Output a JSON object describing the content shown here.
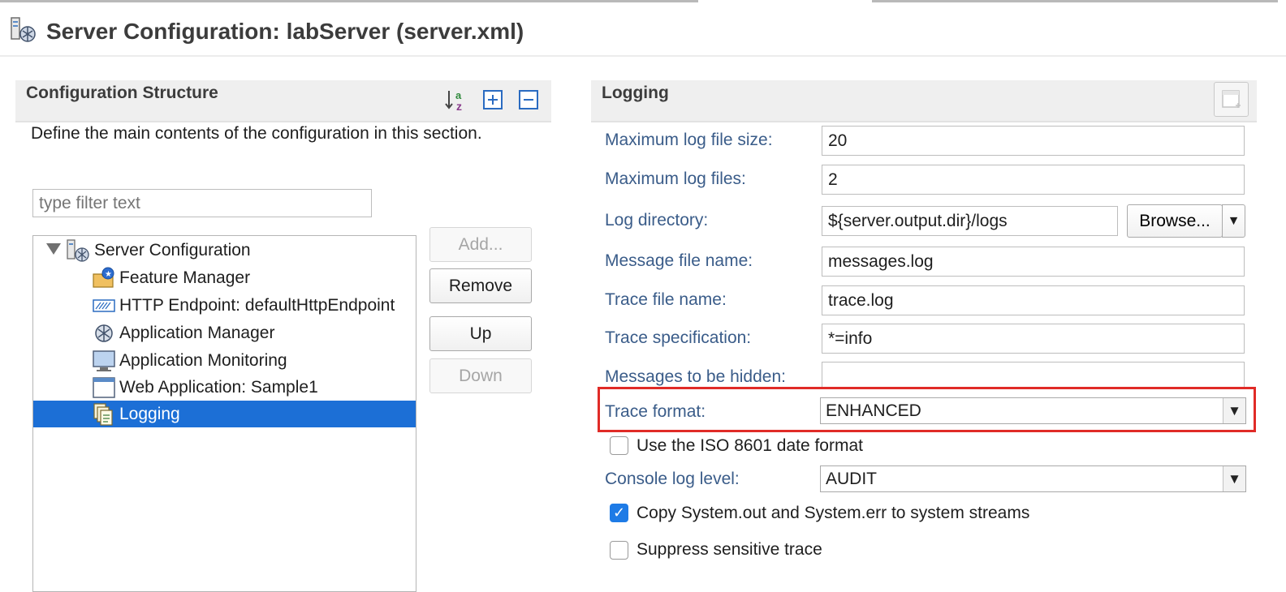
{
  "header": {
    "title": "Server Configuration: labServer (server.xml)"
  },
  "left": {
    "section_title": "Configuration Structure",
    "description": "Define the main contents of the configuration in this section.",
    "filter_placeholder": "type filter text",
    "tree": [
      {
        "label": "Server Configuration",
        "icon": "server-config-icon"
      },
      {
        "label": "Feature Manager",
        "icon": "feature-manager-icon"
      },
      {
        "label": "HTTP Endpoint: defaultHttpEndpoint",
        "icon": "http-endpoint-icon"
      },
      {
        "label": "Application Manager",
        "icon": "application-manager-icon"
      },
      {
        "label": "Application Monitoring",
        "icon": "monitor-icon"
      },
      {
        "label": "Web Application: Sample1",
        "icon": "web-application-icon"
      },
      {
        "label": "Logging",
        "icon": "logging-icon",
        "selected": true
      }
    ],
    "buttons": {
      "add": "Add...",
      "remove": "Remove",
      "up": "Up",
      "down": "Down"
    }
  },
  "right": {
    "section_title": "Logging",
    "fields": {
      "max_log_file_size": {
        "label": "Maximum log file size:",
        "value": "20"
      },
      "max_log_files": {
        "label": "Maximum log files:",
        "value": "2"
      },
      "log_directory": {
        "label": "Log directory:",
        "value": "${server.output.dir}/logs"
      },
      "message_file_name": {
        "label": "Message file name:",
        "value": "messages.log"
      },
      "trace_file_name": {
        "label": "Trace file name:",
        "value": "trace.log"
      },
      "trace_specification": {
        "label": "Trace specification:",
        "value": "*=info"
      },
      "messages_hidden": {
        "label": "Messages to be hidden:",
        "value": ""
      },
      "trace_format": {
        "label": "Trace format:",
        "value": "ENHANCED"
      },
      "console_log_level": {
        "label": "Console log level:",
        "value": "AUDIT"
      }
    },
    "browse_label": "Browse...",
    "checkboxes": {
      "iso_date": {
        "label": "Use the ISO 8601 date format",
        "checked": false
      },
      "copy_system_streams": {
        "label": "Copy System.out and System.err to system streams",
        "checked": true
      },
      "suppress_trace": {
        "label": "Suppress sensitive trace",
        "checked": false
      }
    }
  },
  "colors": {
    "selection": "#1c6fd6",
    "highlight": "#e02b27",
    "label": "#3a5c89"
  }
}
